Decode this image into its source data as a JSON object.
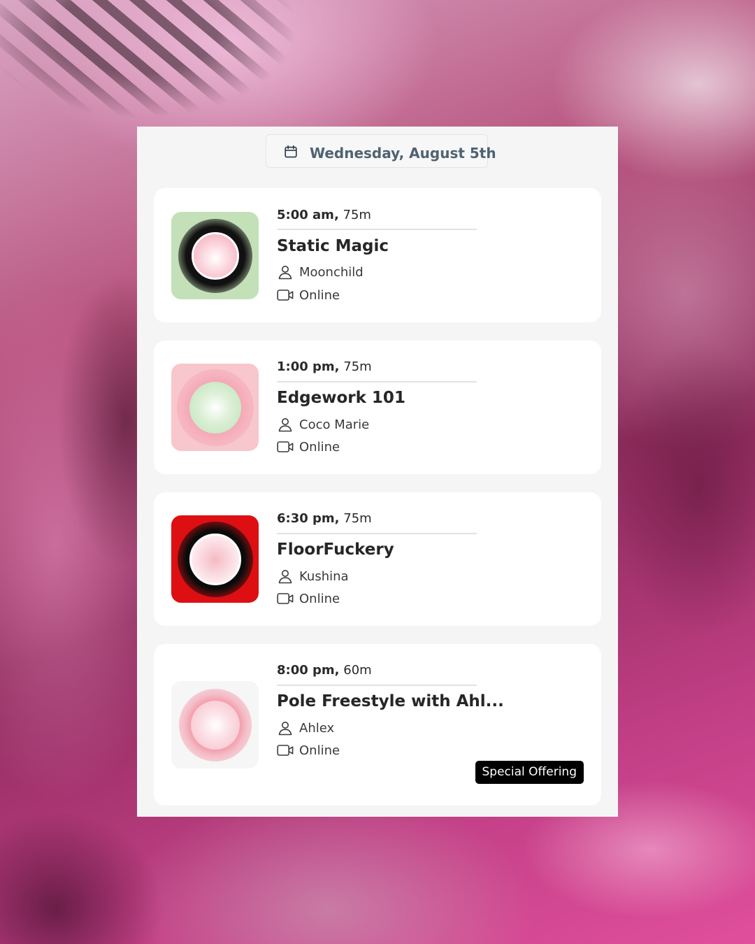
{
  "header": {
    "date": "Wednesday, August 5th",
    "date_icon": "calendar-icon"
  },
  "classes": [
    {
      "time": "5:00 am,",
      "duration": "75m",
      "title": "Static Magic",
      "instructor": "Moonchild",
      "location": "Online",
      "thumb_colors": {
        "background": "#c4e0b8",
        "ring": "#111111",
        "center": "#f7b9c7"
      }
    },
    {
      "time": "1:00 pm,",
      "duration": "75m",
      "title": "Edgework 101",
      "instructor": "Coco Marie",
      "location": "Online",
      "thumb_colors": {
        "background": "#f8c6cd",
        "ring": "#f5a6b4",
        "center": "#c9e7c3"
      }
    },
    {
      "time": "6:30 pm,",
      "duration": "75m",
      "title": "FloorFuckery",
      "instructor": "Kushina",
      "location": "Online",
      "thumb_colors": {
        "background": "#dd0f12",
        "ring": "#111111",
        "center": "#f9d4da"
      }
    },
    {
      "time": "8:00 pm,",
      "duration": "60m",
      "title": "Pole Freestyle with Ahl...",
      "instructor": "Ahlex",
      "location": "Online",
      "badge": "Special Offering",
      "thumb_colors": {
        "background": "#f7f7f7",
        "ring": "#f59aaa",
        "center": "#f8c9d1"
      }
    }
  ],
  "icons": {
    "instructor": "person-icon",
    "location": "video-camera-icon"
  }
}
